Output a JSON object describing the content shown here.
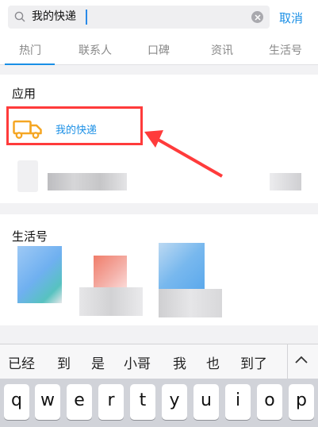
{
  "search": {
    "query": "我的快递",
    "cancel_label": "取消"
  },
  "tabs": [
    {
      "label": "热门"
    },
    {
      "label": "联系人"
    },
    {
      "label": "口碑"
    },
    {
      "label": "资讯"
    },
    {
      "label": "生活号"
    }
  ],
  "apps_section": {
    "title": "应用",
    "item": {
      "label": "我的快递",
      "icon": "truck-icon"
    }
  },
  "life_section": {
    "title": "生活号"
  },
  "keyboard": {
    "suggestions": [
      "已经",
      "到",
      "是",
      "小哥",
      "我",
      "也",
      "到了"
    ],
    "keys": [
      "q",
      "w",
      "e",
      "r",
      "t",
      "y",
      "u",
      "i",
      "o",
      "p"
    ]
  },
  "colors": {
    "accent": "#1a8fe6",
    "highlight": "#ff3b3b",
    "truck": "#f5a623"
  }
}
